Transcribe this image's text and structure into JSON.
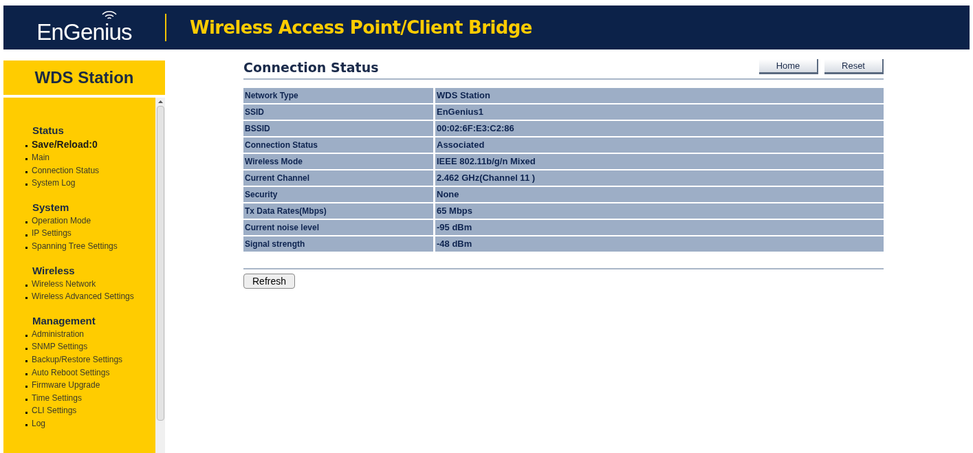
{
  "header": {
    "logo": "EnGenius",
    "title": "Wireless Access Point/Client Bridge"
  },
  "sidebar": {
    "mode": "WDS Station",
    "sections": [
      {
        "heading": "Status",
        "items": [
          {
            "label": "Save/Reload:0",
            "bold": true
          },
          {
            "label": "Main",
            "bold": false
          },
          {
            "label": "Connection Status",
            "bold": false
          },
          {
            "label": "System Log",
            "bold": false
          }
        ]
      },
      {
        "heading": "System",
        "items": [
          {
            "label": "Operation Mode",
            "bold": false
          },
          {
            "label": "IP Settings",
            "bold": false
          },
          {
            "label": "Spanning Tree Settings",
            "bold": false
          }
        ]
      },
      {
        "heading": "Wireless",
        "items": [
          {
            "label": "Wireless Network",
            "bold": false
          },
          {
            "label": "Wireless Advanced Settings",
            "bold": false
          }
        ]
      },
      {
        "heading": "Management",
        "items": [
          {
            "label": "Administration",
            "bold": false
          },
          {
            "label": "SNMP Settings",
            "bold": false
          },
          {
            "label": "Backup/Restore Settings",
            "bold": false
          },
          {
            "label": "Auto Reboot Settings",
            "bold": false
          },
          {
            "label": "Firmware Upgrade",
            "bold": false
          },
          {
            "label": "Time Settings",
            "bold": false
          },
          {
            "label": "CLI Settings",
            "bold": false
          },
          {
            "label": "Log",
            "bold": false
          }
        ]
      }
    ]
  },
  "page": {
    "title": "Connection Status",
    "buttons": [
      "Home",
      "Reset"
    ],
    "rows": [
      {
        "label": "Network Type",
        "value": "WDS Station"
      },
      {
        "label": "SSID",
        "value": "EnGenius1"
      },
      {
        "label": "BSSID",
        "value": "00:02:6F:E3:C2:86"
      },
      {
        "label": "Connection Status",
        "value": "Associated"
      },
      {
        "label": "Wireless Mode",
        "value": "IEEE 802.11b/g/n Mixed"
      },
      {
        "label": "Current Channel",
        "value": "2.462 GHz(Channel 11 )"
      },
      {
        "label": "Security",
        "value": "None"
      },
      {
        "label": "Tx Data Rates(Mbps)",
        "value": "65 Mbps"
      },
      {
        "label": "Current noise level",
        "value": "-95 dBm"
      },
      {
        "label": "Signal strength",
        "value": "-48 dBm"
      }
    ],
    "refresh": "Refresh"
  }
}
